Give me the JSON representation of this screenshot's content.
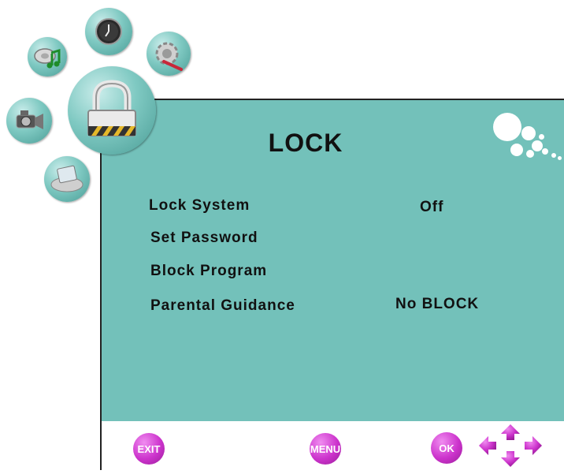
{
  "menu": {
    "title": "LOCK",
    "items": [
      {
        "label": "Lock System",
        "value": "Off"
      },
      {
        "label": "Set Password",
        "value": ""
      },
      {
        "label": "Block Program",
        "value": ""
      },
      {
        "label": "Parental Guidance",
        "value": "No BLOCK"
      }
    ]
  },
  "footer": {
    "exit_label": "EXIT",
    "menu_label": "MENU",
    "ok_label": "OK"
  },
  "icons": {
    "top_nav": [
      "music-icon",
      "clock-icon",
      "settings-icon",
      "video-camera-icon",
      "lock-icon",
      "computer-icon"
    ],
    "footer": [
      "exit-button",
      "menu-button",
      "ok-button",
      "navigation-arrows-icon"
    ]
  },
  "colors": {
    "panel_bg": "#73c1ba",
    "bubble": "#7fc9c2",
    "button": "#cc33cc",
    "text": "#111111"
  }
}
